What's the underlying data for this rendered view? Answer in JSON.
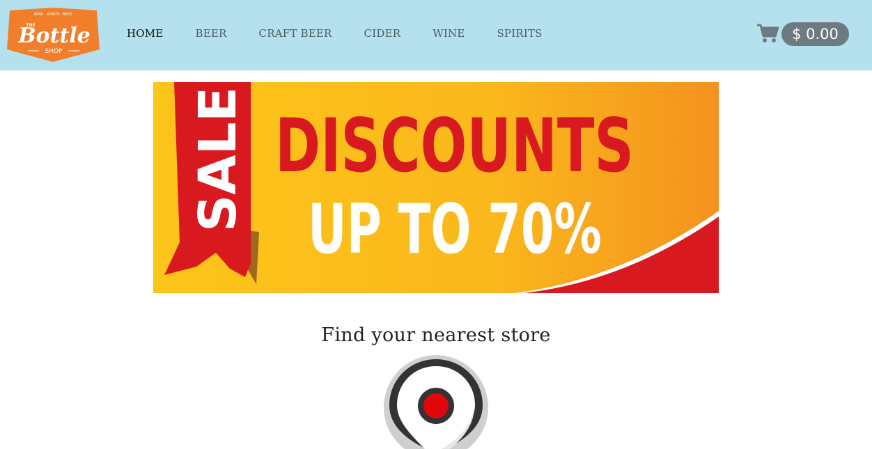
{
  "logo": {
    "top_text": "WINE · SPIRITS · BEER",
    "the_text": "THE",
    "name": "Bottle",
    "sub_text": "SHOP",
    "color": "#f07e2a"
  },
  "nav": {
    "items": [
      {
        "label": "HOME",
        "active": true
      },
      {
        "label": "BEER",
        "active": false
      },
      {
        "label": "CRAFT BEER",
        "active": false
      },
      {
        "label": "CIDER",
        "active": false
      },
      {
        "label": "WINE",
        "active": false
      },
      {
        "label": "SPIRITS",
        "active": false
      }
    ]
  },
  "cart": {
    "icon": "shopping-cart-icon",
    "total": "$ 0.00"
  },
  "banner": {
    "ribbon_text": "SALE",
    "headline": "DISCOUNTS",
    "subline": "UP TO 70%",
    "colors": {
      "background": "#fbb81c",
      "red": "#d8191f",
      "white": "#ffffff"
    }
  },
  "store_locator": {
    "heading": "Find your nearest store",
    "icon": "map-pin-icon",
    "pin_color": "#e0060c"
  }
}
